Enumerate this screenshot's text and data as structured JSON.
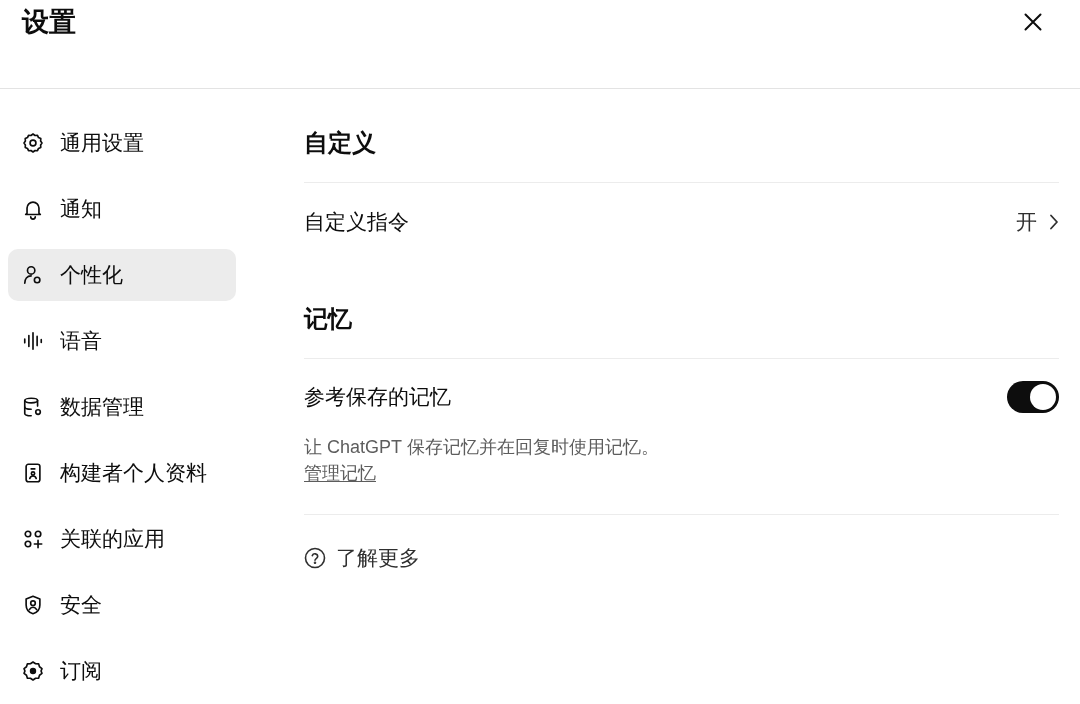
{
  "window": {
    "title": "设置"
  },
  "sidebar": {
    "items": [
      {
        "label": "通用设置",
        "selected": false
      },
      {
        "label": "通知",
        "selected": false
      },
      {
        "label": "个性化",
        "selected": true
      },
      {
        "label": "语音",
        "selected": false
      },
      {
        "label": "数据管理",
        "selected": false
      },
      {
        "label": "构建者个人资料",
        "selected": false
      },
      {
        "label": "关联的应用",
        "selected": false
      },
      {
        "label": "安全",
        "selected": false
      },
      {
        "label": "订阅",
        "selected": false
      }
    ]
  },
  "sections": [
    {
      "title": "自定义",
      "rows": [
        {
          "kind": "link",
          "label": "自定义指令",
          "value": "开"
        }
      ]
    },
    {
      "title": "记忆",
      "rows": [
        {
          "kind": "toggle",
          "label": "参考保存的记忆",
          "on": true,
          "description": "让 ChatGPT 保存记忆并在回复时使用记忆。",
          "link": "管理记忆"
        }
      ]
    }
  ],
  "learn_more": {
    "label": "了解更多"
  }
}
